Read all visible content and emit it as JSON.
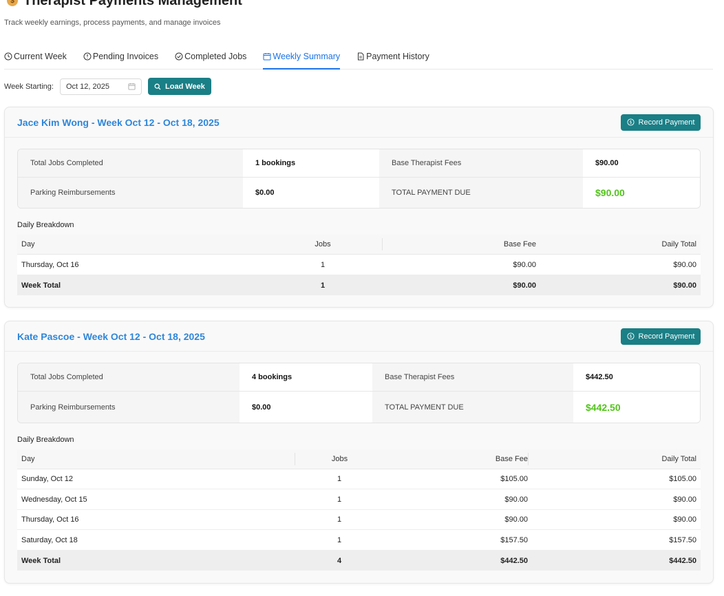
{
  "header": {
    "title": "Therapist Payments Management",
    "subtitle": "Track weekly earnings, process payments, and manage invoices",
    "icon": "money-bag-icon"
  },
  "tabs": [
    {
      "label": "Current Week",
      "icon": "clock-icon"
    },
    {
      "label": "Pending Invoices",
      "icon": "alert-circle-icon"
    },
    {
      "label": "Completed Jobs",
      "icon": "check-circle-icon"
    },
    {
      "label": "Weekly Summary",
      "icon": "calendar-icon",
      "active": true
    },
    {
      "label": "Payment History",
      "icon": "file-icon"
    }
  ],
  "filters": {
    "week_label": "Week Starting:",
    "week_value": "Oct 12, 2025",
    "load_button": "Load Week"
  },
  "colors": {
    "accent": "#1a73e8",
    "primary_button": "#1a7f86",
    "title_blue": "#2f86d9",
    "total_green": "#52c41a"
  },
  "summaries": [
    {
      "title": "Jace Kim Wong - Week Oct 12 - Oct 18, 2025",
      "record_button": "Record Payment",
      "jobs_label": "Total Jobs Completed",
      "jobs_value": "1 bookings",
      "base_label": "Base Therapist Fees",
      "base_value": "$90.00",
      "parking_label": "Parking Reimbursements",
      "parking_value": "$0.00",
      "due_label": "TOTAL PAYMENT DUE",
      "due_value": "$90.00",
      "breakdown_title": "Daily Breakdown",
      "columns": [
        "Day",
        "Jobs",
        "Base Fee",
        "Daily Total"
      ],
      "rows": [
        {
          "day": "Thursday, Oct 16",
          "jobs": "1",
          "base": "$90.00",
          "total": "$90.00"
        }
      ],
      "week_total": {
        "day": "Week Total",
        "jobs": "1",
        "base": "$90.00",
        "total": "$90.00"
      }
    },
    {
      "title": "Kate Pascoe - Week Oct 12 - Oct 18, 2025",
      "record_button": "Record Payment",
      "jobs_label": "Total Jobs Completed",
      "jobs_value": "4 bookings",
      "base_label": "Base Therapist Fees",
      "base_value": "$442.50",
      "parking_label": "Parking Reimbursements",
      "parking_value": "$0.00",
      "due_label": "TOTAL PAYMENT DUE",
      "due_value": "$442.50",
      "breakdown_title": "Daily Breakdown",
      "columns": [
        "Day",
        "Jobs",
        "Base Fee",
        "Daily Total"
      ],
      "rows": [
        {
          "day": "Sunday, Oct 12",
          "jobs": "1",
          "base": "$105.00",
          "total": "$105.00"
        },
        {
          "day": "Wednesday, Oct 15",
          "jobs": "1",
          "base": "$90.00",
          "total": "$90.00"
        },
        {
          "day": "Thursday, Oct 16",
          "jobs": "1",
          "base": "$90.00",
          "total": "$90.00"
        },
        {
          "day": "Saturday, Oct 18",
          "jobs": "1",
          "base": "$157.50",
          "total": "$157.50"
        }
      ],
      "week_total": {
        "day": "Week Total",
        "jobs": "4",
        "base": "$442.50",
        "total": "$442.50"
      }
    }
  ]
}
